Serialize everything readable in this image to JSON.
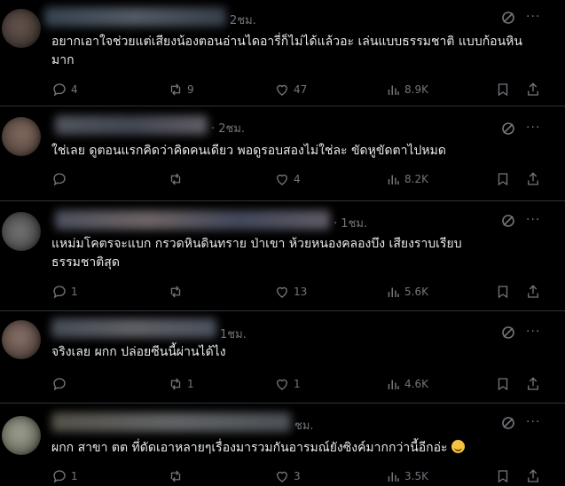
{
  "colors": {
    "background": "#000000",
    "text": "#e7e9ea",
    "muted": "#71767b",
    "divider": "#2f3336"
  },
  "replies": [
    {
      "timestamp": "2ชม.",
      "text": "อยากเอาใจช่วยแต่เสียงน้องตอนอ่านไดอารี่ก็ไม่ได้แล้วอะ เล่นแบบธรรมชาติ แบบก้อนหินมาก",
      "replies_count": "4",
      "reposts_count": "9",
      "likes_count": "47",
      "views_count": "8.9K"
    },
    {
      "timestamp": "· 2ชม.",
      "text": "ใช่เลย  ดูตอนแรกคิดว่าคิดคนเดียว พอดูรอบสองไม่ใช่ละ ขัดหูขัดตาไปหมด",
      "replies_count": "",
      "reposts_count": "",
      "likes_count": "4",
      "views_count": "8.2K"
    },
    {
      "timestamp": "· 1ชม.",
      "text": "แหม่มโคตรจะแบก กรวดหินดินทราย ป่าเขา ห้วยหนองคลองบึง เสียงราบเรียบธรรมชาติสุด",
      "replies_count": "1",
      "reposts_count": "",
      "likes_count": "13",
      "views_count": "5.6K"
    },
    {
      "timestamp": "1ชม.",
      "text": "จริงเลย ผกก ปล่อยซีนนี้ผ่านได้ไง",
      "replies_count": "",
      "reposts_count": "1",
      "likes_count": "1",
      "views_count": "4.6K"
    },
    {
      "timestamp": "ชม.",
      "text": "ผกก สาขา ตต ที่ดัดเอาหลายๆเรื่องมารวมกันอารมณ์ยังซิงค์มากกว่านี้อีกอ่ะ",
      "emoji": "smiling-face-emoji",
      "replies_count": "1",
      "reposts_count": "",
      "likes_count": "3",
      "views_count": "3.5K"
    }
  ]
}
